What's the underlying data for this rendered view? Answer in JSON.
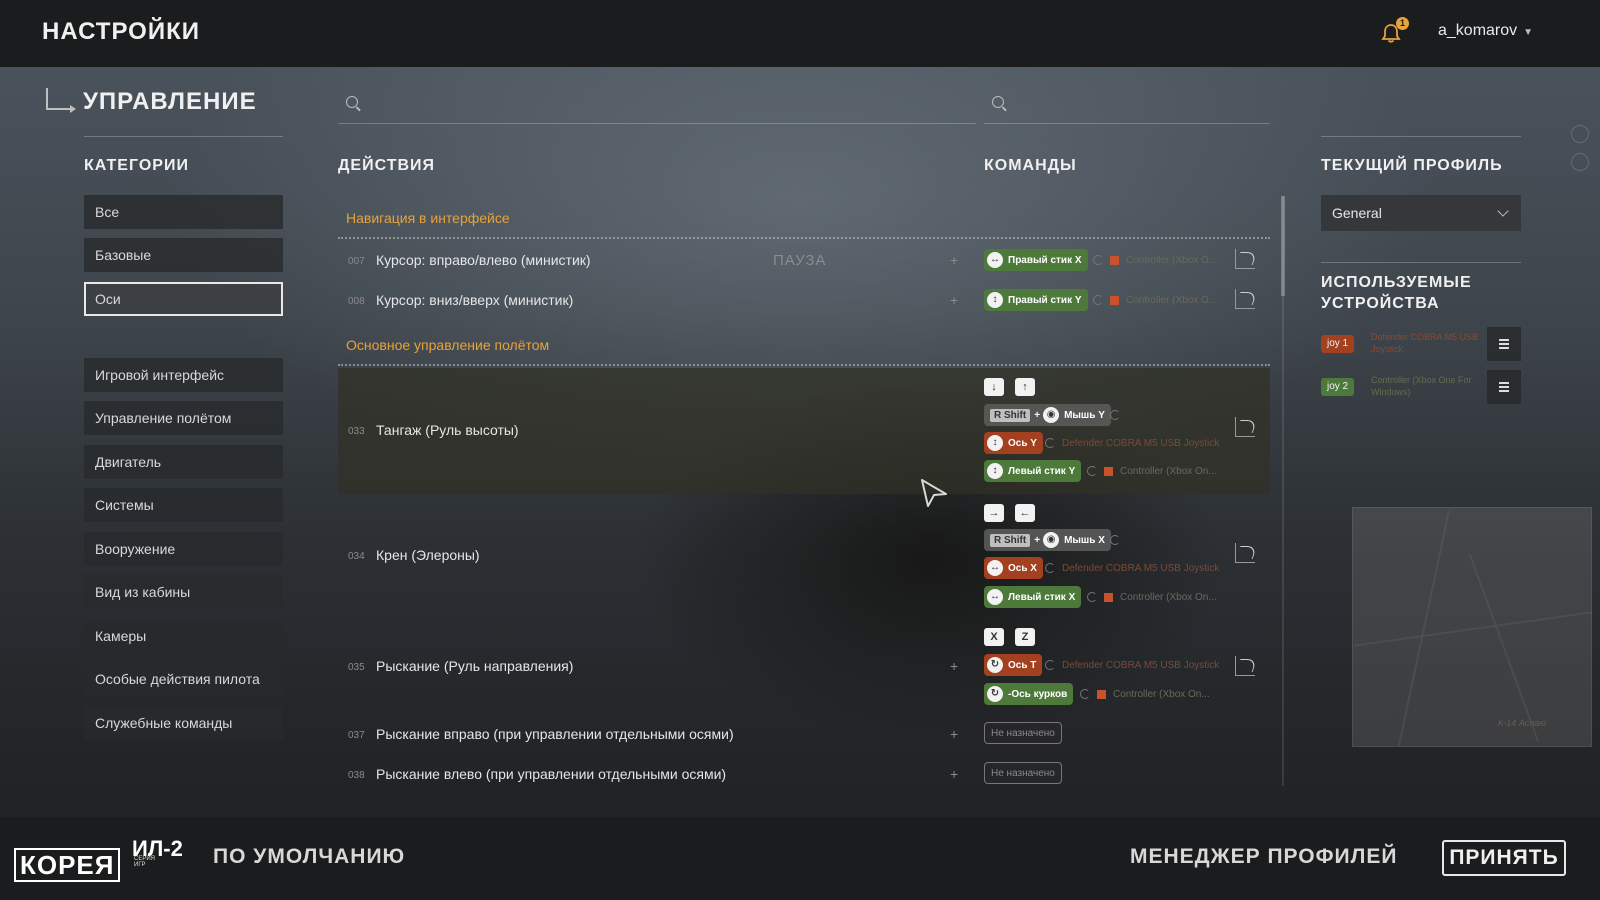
{
  "header": {
    "title": "НАСТРОЙКИ",
    "notification_count": "1",
    "username": "a_komarov"
  },
  "section": {
    "title": "УПРАВЛЕНИЕ"
  },
  "search": {
    "actions_placeholder": "",
    "commands_placeholder": ""
  },
  "columns": {
    "categories": "КАТЕГОРИИ",
    "actions": "ДЕЙСТВИЯ",
    "commands": "КОМАНДЫ",
    "current_profile": "ТЕКУЩИЙ ПРОФИЛЬ",
    "devices": "ИСПОЛЬЗУЕМЫЕ УСТРОЙСТВА"
  },
  "categories": [
    {
      "label": "Все",
      "active": false
    },
    {
      "label": "Базовые",
      "active": false
    },
    {
      "label": "Оси",
      "active": true
    },
    {
      "label": "Игровой интерфейс",
      "active": false
    },
    {
      "label": "Управление полётом",
      "active": false
    },
    {
      "label": "Двигатель",
      "active": false
    },
    {
      "label": "Системы",
      "active": false
    },
    {
      "label": "Вооружение",
      "active": false
    },
    {
      "label": "Вид из кабины",
      "active": false
    },
    {
      "label": "Камеры",
      "active": false
    },
    {
      "label": "Особые действия пилота",
      "active": false
    },
    {
      "label": "Служебные команды",
      "active": false
    }
  ],
  "groups": [
    {
      "title": "Навигация в интерфейсе"
    },
    {
      "title": "Основное управление полётом"
    }
  ],
  "pause_label": "ПАУЗА",
  "actions": [
    {
      "num": "007",
      "label": "Курсор: вправо/влево (министик)"
    },
    {
      "num": "008",
      "label": "Курсор: вниз/вверх (министик)"
    },
    {
      "num": "033",
      "label": "Тангаж (Руль высоты)"
    },
    {
      "num": "034",
      "label": "Крен (Элероны)"
    },
    {
      "num": "035",
      "label": "Рыскание (Руль направления)"
    },
    {
      "num": "037",
      "label": "Рыскание вправо (при управлении отдельными осями)"
    },
    {
      "num": "038",
      "label": "Рыскание влево (при управлении отдельными осями)"
    }
  ],
  "bindings": {
    "right_stick_x": "Правый стик X",
    "right_stick_y": "Правый стик Y",
    "controller_short": "Controller (Xbox O...",
    "controller_short2": "Controller (Xbox On...",
    "rshift": "R Shift",
    "plus": "+",
    "mouse_y": "Мышь Y",
    "mouse_x": "Мышь X",
    "axis_y": "Ось Y",
    "axis_x": "Ось X",
    "axis_t": "Ось T",
    "left_stick_y": "Левый стик Y",
    "left_stick_x": "Левый стик X",
    "triggers_axis": "-Ось курков",
    "joystick_name": "Defender COBRA M5 USB Joystick",
    "key_down": "↓",
    "key_up": "↑",
    "key_right": "→",
    "key_left": "←",
    "key_x": "X",
    "key_z": "Z",
    "unassigned": "Не назначено"
  },
  "profile": {
    "selected": "General"
  },
  "devices": [
    {
      "tag": "joy 1",
      "name": "Defender COBRA M5 USB Joystick",
      "tag_color": "#a24020",
      "name_color": "#8a4a30"
    },
    {
      "tag": "joy 2",
      "name": "Controller (Xbox One For Windows)",
      "tag_color": "#4d7a3a",
      "name_color": "#5e6e4e"
    }
  ],
  "minimap": {
    "label": "К-14 Аслаю"
  },
  "footer": {
    "logo_main": "КОРЕЯ",
    "logo_il2": "ИЛ-2",
    "logo_series": "СЕРИЯ ИГР",
    "default_button": "ПО УМОЛЧАНИЮ",
    "profile_manager_button": "МЕНЕДЖЕР ПРОФИЛЕЙ",
    "accept_button": "ПРИНЯТЬ"
  },
  "colors": {
    "accent": "#e8a23a",
    "gamepad": "#4d7a3a",
    "joystick": "#a24020"
  }
}
